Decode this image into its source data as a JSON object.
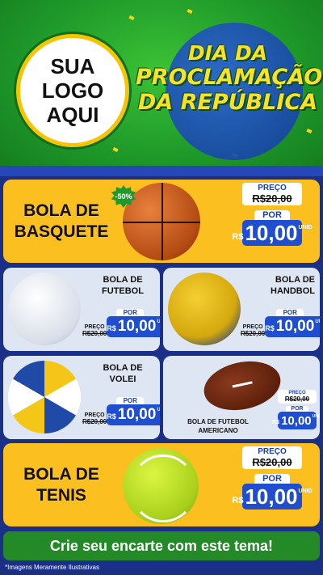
{
  "hero": {
    "logo_line1": "SUA",
    "logo_line2": "LOGO",
    "logo_line3": "AQUI",
    "title_line1": "DIA DA",
    "title_line2": "PROCLAMAÇÃO",
    "title_line3": "DA REPÚBLICA"
  },
  "labels": {
    "preco": "PREÇO",
    "por": "POR",
    "currency": "R$",
    "unit": "UNID"
  },
  "products": {
    "basquete": {
      "name_line1": "BOLA DE",
      "name_line2": "BASQUETE",
      "badge": "-50%",
      "old_price": "R$20,00",
      "new_price": "10,00"
    },
    "futebol": {
      "name_line1": "BOLA DE",
      "name_line2": "FUTEBOL",
      "old_price": "R$20,00",
      "new_price": "10,00"
    },
    "handbol": {
      "name_line1": "BOLA DE",
      "name_line2": "HANDBOL",
      "old_price": "R$20,00",
      "new_price": "10,00"
    },
    "volei": {
      "name_line1": "BOLA DE",
      "name_line2": "VOLEI",
      "old_price": "R$20,00",
      "new_price": "10,00"
    },
    "americano": {
      "name_line1": "BOLA DE FUTEBOL",
      "name_line2": "AMERICANO",
      "old_price": "R$20,00",
      "new_price": "10,00"
    },
    "tenis": {
      "name_line1": "BOLA DE",
      "name_line2": "TENIS",
      "old_price": "R$20,00",
      "new_price": "10,00"
    }
  },
  "cta": "Crie seu encarte com este tema!",
  "footnote": "*Imagens Meramente Ilustrativas",
  "colors": {
    "green": "#1f9b2a",
    "yellow": "#fbbf1f",
    "blue": "#1f4fd0",
    "navy": "#1a2f86"
  }
}
